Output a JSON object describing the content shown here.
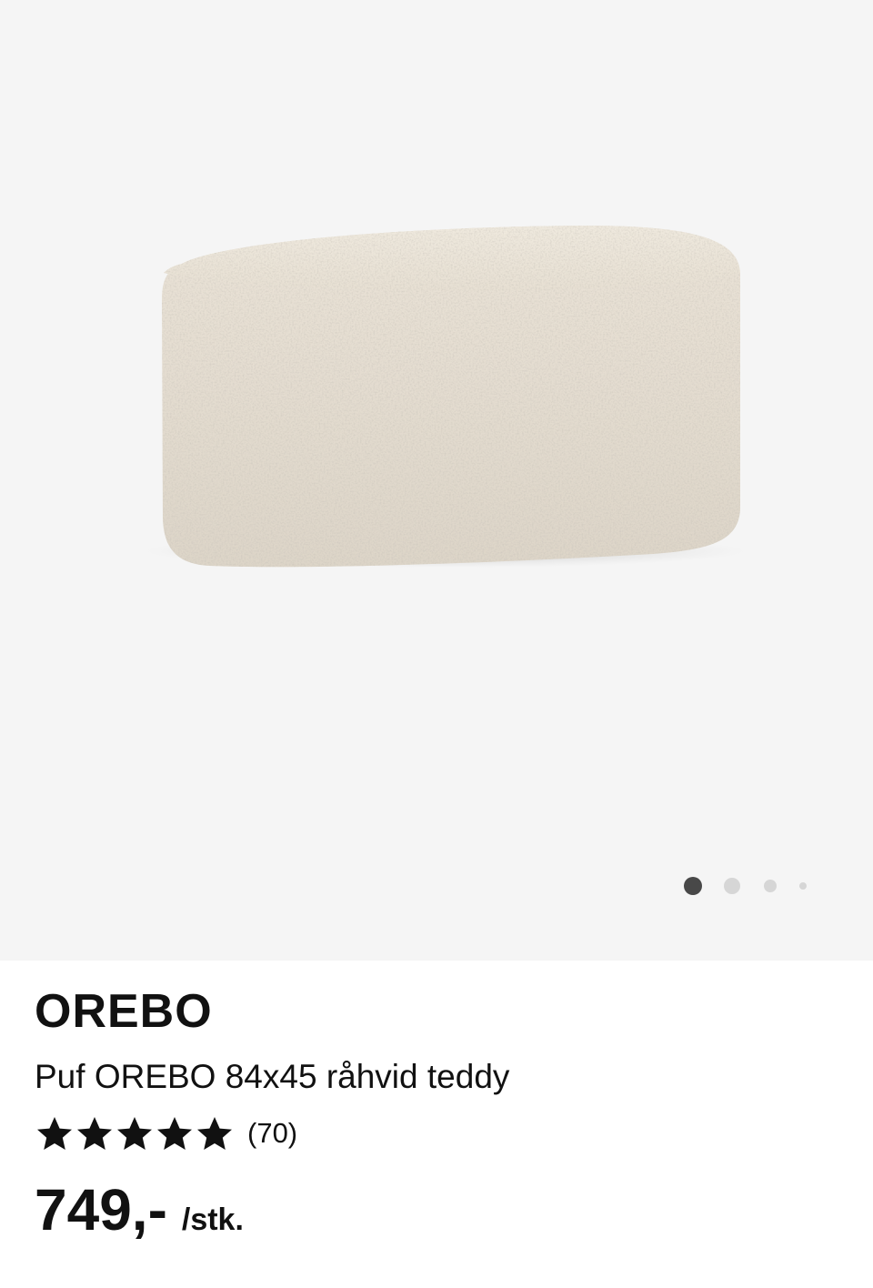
{
  "gallery": {
    "image_alt": "",
    "slide_count": 4,
    "active_slide": 1
  },
  "product": {
    "name": "OREBO",
    "description": "Puf OREBO 84x45 råhvid teddy",
    "rating": 5,
    "rating_max": 5,
    "review_count": "(70)",
    "price": "749,-",
    "price_unit": "/stk."
  },
  "colors": {
    "gallery_bg": "#f5f5f5",
    "text": "#111111",
    "dot_active": "#484848",
    "dot_inactive": "#d6d6d6"
  },
  "icons": {
    "star": "star-icon"
  }
}
